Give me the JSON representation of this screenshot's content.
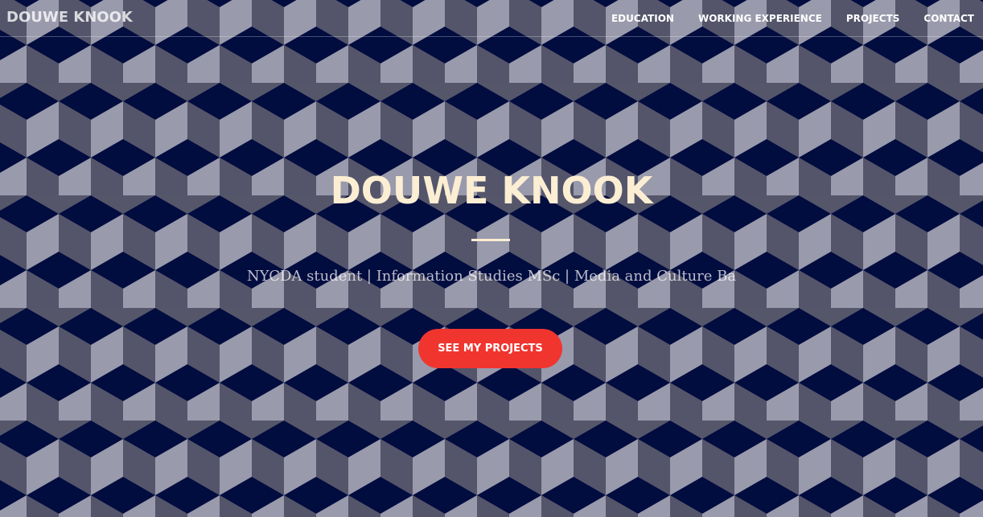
{
  "nav": {
    "brand": "DOUWE KNOOK",
    "links": [
      "EDUCATION",
      "WORKING EXPERIENCE",
      "PROJECTS",
      "CONTACT"
    ]
  },
  "hero": {
    "title": "DOUWE KNOOK",
    "subtitle": "NYCDA student | Information Studies MSc | Media and Culture Ba",
    "cta_label": "SEE MY PROJECTS"
  },
  "colors": {
    "title": "#fbeed3",
    "cta_background": "#f0352f",
    "cube_top": "#010c3f",
    "cube_left": "#54556a",
    "cube_right": "#9a9aad"
  },
  "background": {
    "pattern": "isometric-cubes"
  }
}
